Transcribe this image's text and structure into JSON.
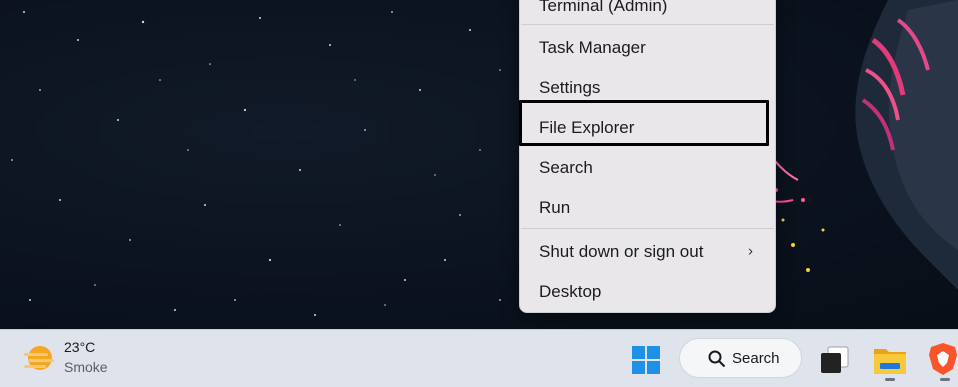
{
  "context_menu": {
    "items": [
      {
        "label": "Terminal (Admin)"
      },
      {
        "label": "Task Manager"
      },
      {
        "label": "Settings"
      },
      {
        "label": "File Explorer"
      },
      {
        "label": "Search"
      },
      {
        "label": "Run"
      },
      {
        "label": "Shut down or sign out",
        "submenu_indicator": "›"
      },
      {
        "label": "Desktop"
      }
    ],
    "highlighted_item": "File Explorer"
  },
  "taskbar": {
    "weather": {
      "temperature": "23°C",
      "condition": "Smoke",
      "icon": "haze-sun-icon"
    },
    "search_label": "Search",
    "apps": [
      {
        "name": "start-icon"
      },
      {
        "name": "task-view-icon"
      },
      {
        "name": "file-explorer-icon",
        "running": true
      },
      {
        "name": "brave-browser-icon",
        "running": true
      }
    ]
  },
  "colors": {
    "menu_background": "#e9e7ea",
    "taskbar_background": "#dfe4ec",
    "highlight_border": "#000000",
    "desktop_background": "#0a111c"
  }
}
